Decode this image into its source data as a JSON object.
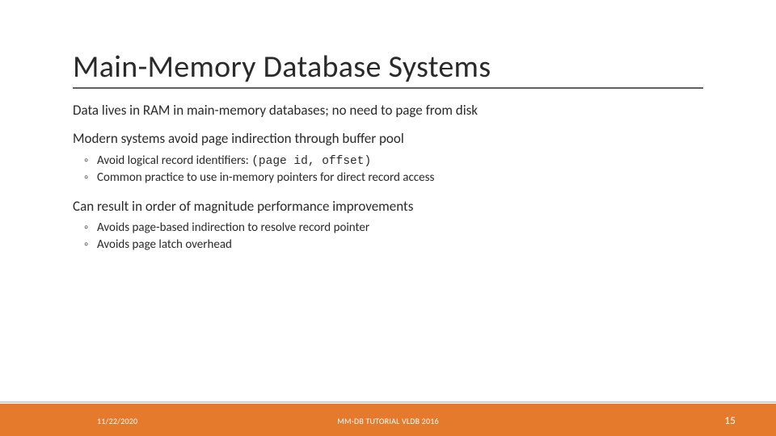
{
  "title": "Main-Memory Database Systems",
  "body": {
    "line1": "Data lives in RAM in main-memory databases; no need to page from disk",
    "line2": "Modern systems avoid page indirection through buffer pool",
    "sub2": {
      "a_prefix": "Avoid logical record identifiers: ",
      "a_mono": "(page id, offset)",
      "b": "Common practice to use in-memory pointers for direct record access"
    },
    "line3": "Can result in order of magnitude performance improvements",
    "sub3": {
      "a": "Avoids page-based indirection to resolve record pointer",
      "b": "Avoids page latch overhead"
    }
  },
  "footer": {
    "date": "11/22/2020",
    "center": "MM-DB TUTORIAL VLDB 2016",
    "page": "15"
  }
}
